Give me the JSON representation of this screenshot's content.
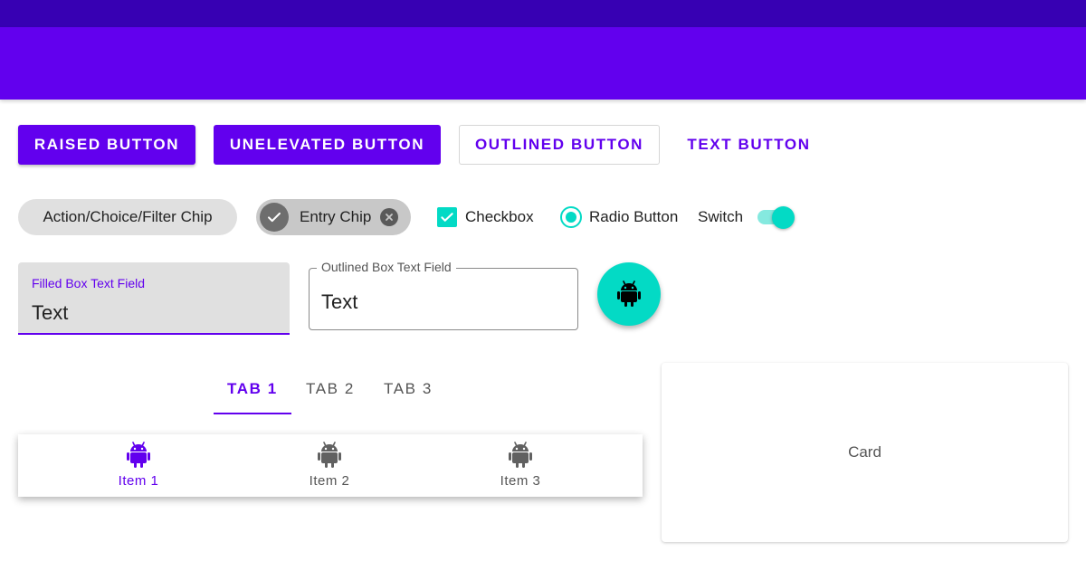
{
  "app": {
    "status_bar_color": "#3700b3",
    "app_bar_color": "#6200ee",
    "accent_color": "#03dac5"
  },
  "buttons": {
    "raised": "RAISED BUTTON",
    "unelevated": "UNELEVATED BUTTON",
    "outlined": "OUTLINED BUTTON",
    "text": "TEXT BUTTON"
  },
  "chips": {
    "action": "Action/Choice/Filter Chip",
    "entry": "Entry Chip",
    "entry_leading_icon": "check-icon",
    "entry_trailing_icon": "close-icon"
  },
  "checkbox": {
    "label": "Checkbox",
    "checked": true
  },
  "radio": {
    "label": "Radio Button",
    "selected": true
  },
  "switch": {
    "label": "Switch",
    "on": true
  },
  "filled_field": {
    "label": "Filled Box Text Field",
    "value": "Text"
  },
  "outlined_field": {
    "label": "Outlined Box Text Field",
    "value": "Text"
  },
  "fab": {
    "icon": "android-icon"
  },
  "tabs": [
    {
      "label": "TAB 1",
      "selected": true
    },
    {
      "label": "TAB 2",
      "selected": false
    },
    {
      "label": "TAB 3",
      "selected": false
    }
  ],
  "bottom_nav": [
    {
      "label": "Item 1",
      "icon": "android-icon",
      "selected": true
    },
    {
      "label": "Item 2",
      "icon": "android-icon",
      "selected": false
    },
    {
      "label": "Item 3",
      "icon": "android-icon",
      "selected": false
    }
  ],
  "card": {
    "label": "Card"
  }
}
